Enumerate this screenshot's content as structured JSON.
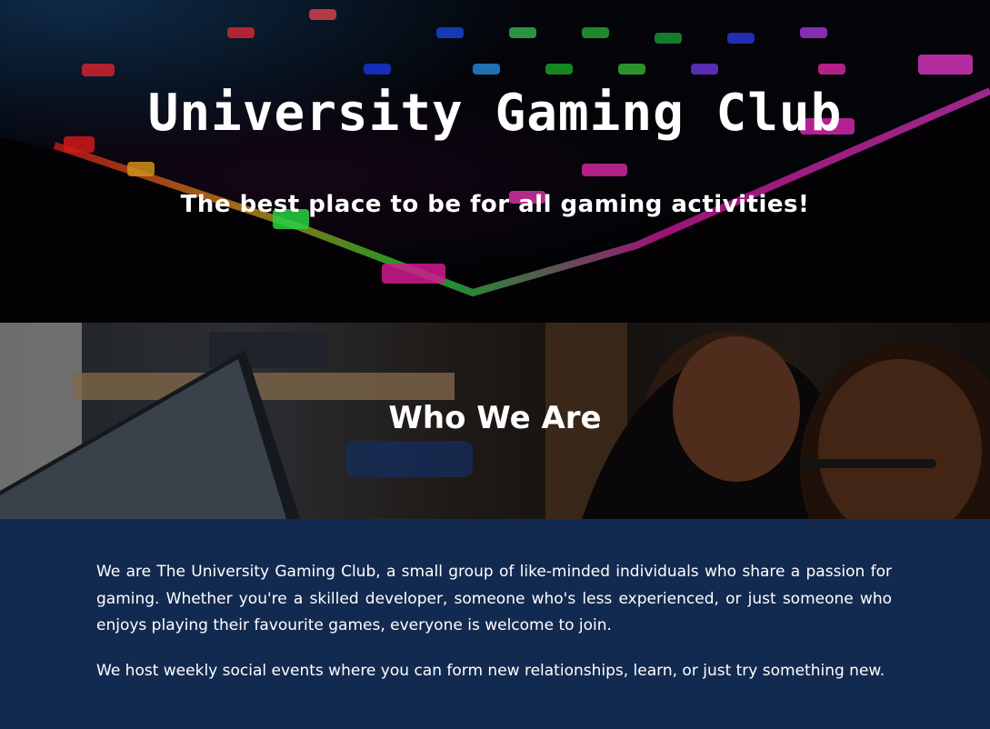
{
  "hero": {
    "title": "University Gaming Club",
    "subtitle": "The best place to be for all gaming activities!",
    "background_image": "rgb-keyboard-photo"
  },
  "who_we_are": {
    "heading": "Who We Are",
    "background_image": "students-at-computer-photo"
  },
  "about": {
    "paragraph_1": "We are The University Gaming Club, a small group of like-minded individuals who share a passion for gaming. Whether you're a skilled developer, someone who's less experienced, or just someone who enjoys playing their favourite games, everyone is welcome to join.",
    "paragraph_2": "We host weekly social events where you can form new relationships, learn, or just try something new."
  },
  "colors": {
    "section_background": "#132a50",
    "text": "#ffffff"
  }
}
